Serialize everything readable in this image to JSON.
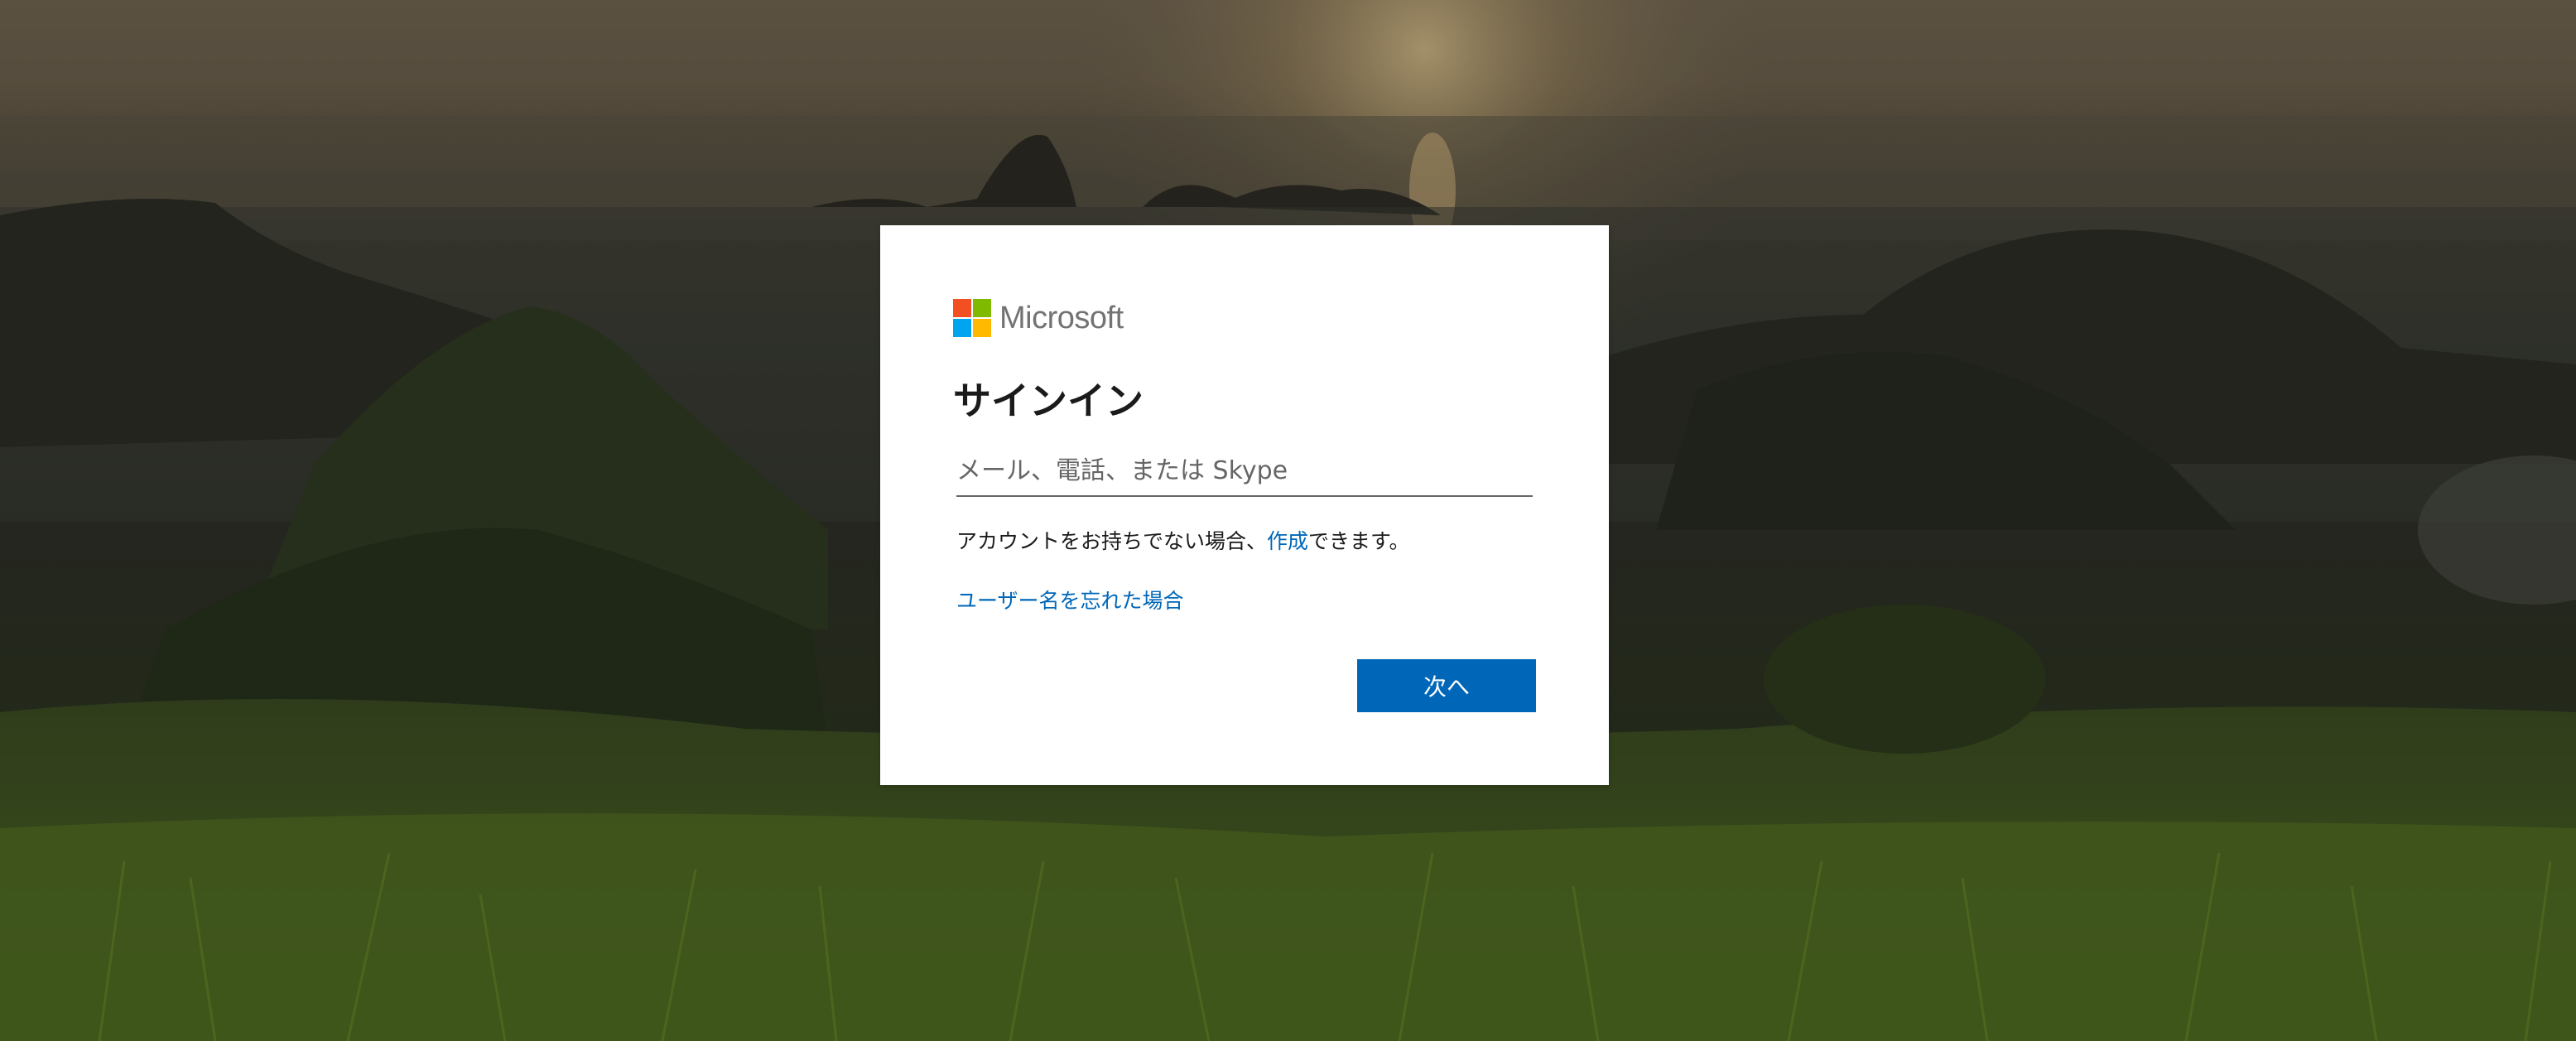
{
  "brand": {
    "name": "Microsoft",
    "logo_colors": [
      "#f25022",
      "#7fba00",
      "#00a4ef",
      "#ffb900"
    ]
  },
  "signin": {
    "title": "サインイン",
    "input_placeholder": "メール、電話、または Skype",
    "input_value": "",
    "no_account_prefix": "アカウントをお持ちでない場合、",
    "create_link": "作成",
    "no_account_suffix": "できます。",
    "forgot_username_link": "ユーザー名を忘れた場合",
    "next_button": "次へ"
  },
  "colors": {
    "accent": "#0067b8",
    "card_bg": "#ffffff",
    "text": "#1b1b1b"
  }
}
